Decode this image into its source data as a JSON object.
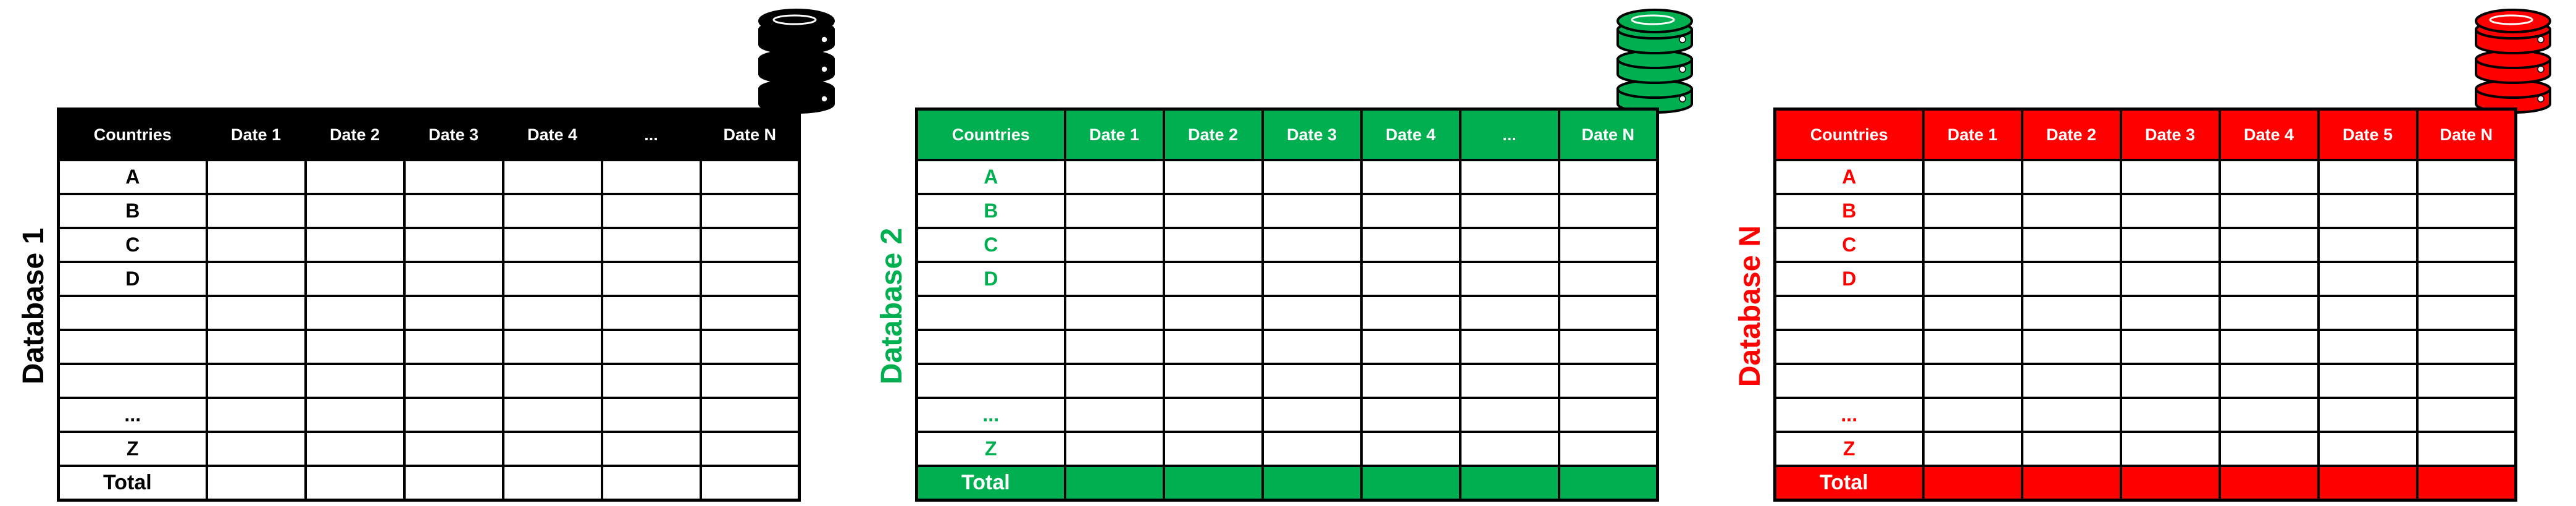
{
  "colors": {
    "db1": "#000000",
    "db2": "#00b050",
    "db3": "#ff0000",
    "white": "#ffffff"
  },
  "panels": [
    {
      "side_label": "Database 1",
      "icon": "database-icon",
      "headers": [
        "Countries",
        "Date 1",
        "Date 2",
        "Date 3",
        "Date 4",
        "...",
        "Date N"
      ],
      "rows": [
        "A",
        "B",
        "C",
        "D",
        "",
        "",
        "",
        "...",
        "Z"
      ],
      "total_label": "Total"
    },
    {
      "side_label": "Database 2",
      "icon": "database-icon",
      "headers": [
        "Countries",
        "Date 1",
        "Date 2",
        "Date 3",
        "Date 4",
        "...",
        "Date N"
      ],
      "rows": [
        "A",
        "B",
        "C",
        "D",
        "",
        "",
        "",
        "...",
        "Z"
      ],
      "total_label": "Total"
    },
    {
      "side_label": "Database N",
      "icon": "database-icon",
      "headers": [
        "Countries",
        "Date 1",
        "Date 2",
        "Date 3",
        "Date 4",
        "Date 5",
        "Date N"
      ],
      "rows": [
        "A",
        "B",
        "C",
        "D",
        "",
        "",
        "",
        "...",
        "Z"
      ],
      "total_label": "Total"
    }
  ]
}
